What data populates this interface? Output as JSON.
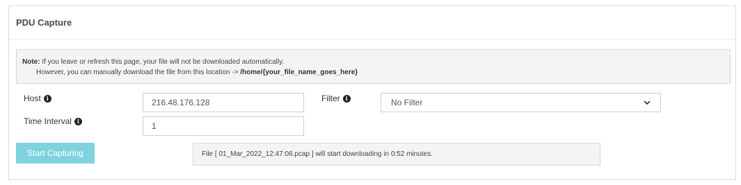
{
  "panel": {
    "title": "PDU Capture"
  },
  "note": {
    "label": "Note:",
    "line1": " If you leave or refresh this page, your file will not be downloaded automatically.",
    "line2_prefix": "However, you can manually download the file from this location -> ",
    "path": "/home/{your_file_name_goes_here}"
  },
  "form": {
    "host_label": "Host",
    "host_value": "216.48.176.128",
    "time_interval_label": "Time Interval",
    "time_interval_value": "1",
    "filter_label": "Filter",
    "filter_value": "No Filter"
  },
  "actions": {
    "start_label": "Start Capturing"
  },
  "status": {
    "message": "File [ 01_Mar_2022_12:47:06.pcap ] will start downloading in 0:52 minutes."
  },
  "colors": {
    "start_button": "#7fd3df",
    "note_background": "#f4f4f4"
  },
  "icons": {
    "info": "info-circle-icon",
    "select_arrow": "chevron-down-icon"
  }
}
